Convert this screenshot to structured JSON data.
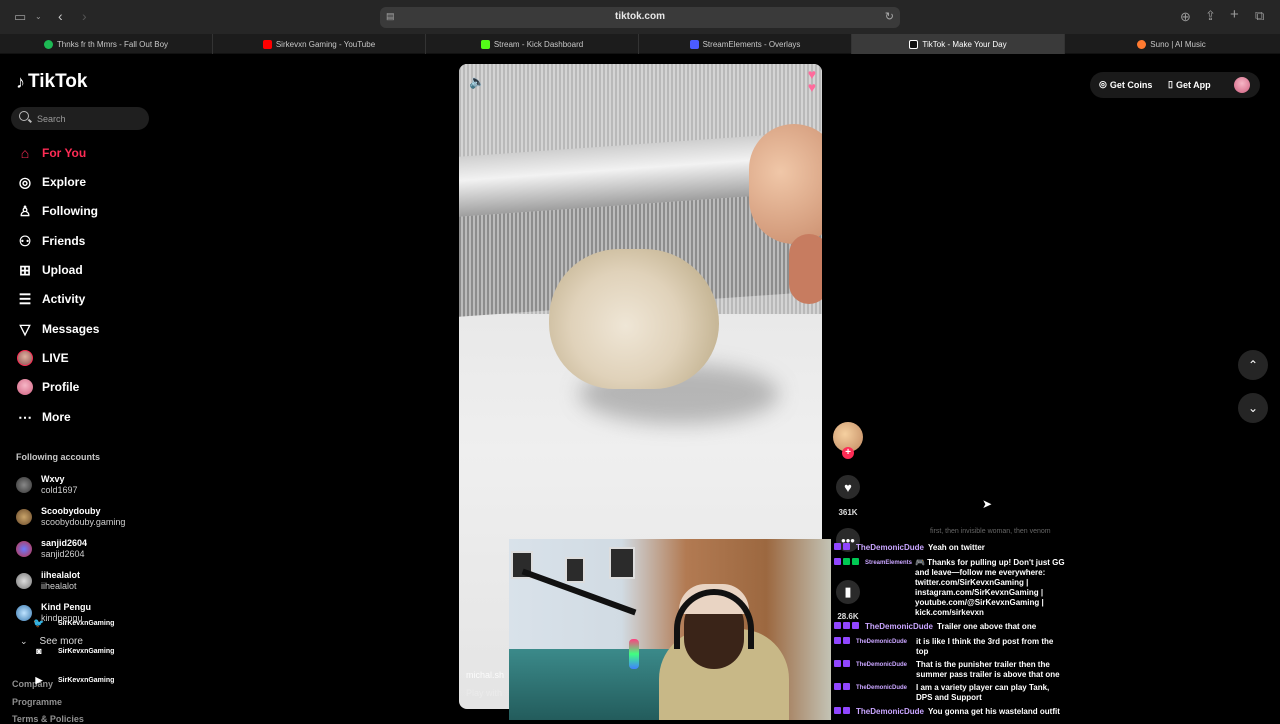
{
  "browser": {
    "url": "tiktok.com",
    "tabs": [
      {
        "label": "Thnks fr th Mmrs - Fall Out Boy",
        "icon": "spotify-icon",
        "color": "#1db954"
      },
      {
        "label": "Sirkevxn Gaming - YouTube",
        "icon": "youtube-icon",
        "color": "#ff0000"
      },
      {
        "label": "Stream - Kick Dashboard",
        "icon": "kick-icon",
        "color": "#53fc18"
      },
      {
        "label": "StreamElements - Overlays",
        "icon": "streamelements-icon",
        "color": "#4b5cff"
      },
      {
        "label": "TikTok - Make Your Day",
        "icon": "tiktok-icon",
        "color": "#ffffff",
        "active": true
      },
      {
        "label": "Suno | AI Music",
        "icon": "suno-icon",
        "color": "#ff7a30"
      }
    ]
  },
  "tiktok": {
    "brand": "TikTok",
    "search_placeholder": "Search",
    "nav": [
      {
        "label": "For You",
        "icon": "home-icon",
        "active": true
      },
      {
        "label": "Explore",
        "icon": "compass-icon"
      },
      {
        "label": "Following",
        "icon": "following-icon"
      },
      {
        "label": "Friends",
        "icon": "friends-icon"
      },
      {
        "label": "Upload",
        "icon": "upload-icon"
      },
      {
        "label": "Activity",
        "icon": "activity-icon"
      },
      {
        "label": "Messages",
        "icon": "messages-icon"
      },
      {
        "label": "LIVE",
        "icon": "live-avatar-icon"
      },
      {
        "label": "Profile",
        "icon": "profile-avatar-icon"
      },
      {
        "label": "More",
        "icon": "more-icon"
      }
    ],
    "following_title": "Following accounts",
    "accounts": [
      {
        "name": "Wxvy",
        "handle": "cold1697"
      },
      {
        "name": "Scoobydouby",
        "handle": "scoobydouby.gaming"
      },
      {
        "name": "sanjid2604",
        "handle": "sanjid2604"
      },
      {
        "name": "iihealalot",
        "handle": "iihealalot"
      },
      {
        "name": "Kind Pengu",
        "handle": "kindpengu"
      }
    ],
    "see_more": "See more",
    "footer": [
      "Company",
      "Programme",
      "Terms & Policies"
    ],
    "top_right": {
      "coins": "Get Coins",
      "app": "Get App"
    },
    "video": {
      "author": "michal.sh",
      "desc": "Play with"
    },
    "actions": {
      "likes": "361K",
      "saves": "28.6K"
    }
  },
  "overlay": {
    "socials": [
      {
        "icon": "twitter-icon",
        "label": "SirKevxnGaming"
      },
      {
        "icon": "instagram-icon",
        "label": "SirKevxnGaming"
      },
      {
        "icon": "youtube-icon",
        "label": "SirKevxnGaming"
      }
    ],
    "chat_faded": "first, then invisible woman, then venom",
    "chat": [
      {
        "user": "TheDemonicDude",
        "msg": "Yeah on twitter"
      },
      {
        "user": "StreamElements",
        "msg": "🎮 Thanks for pulling up! Don't just GG and leave—follow me everywhere: twitter.com/SirKevxnGaming | instagram.com/SirKevxnGaming | youtube.com/@SirKevxnGaming | kick.com/sirkevxn"
      },
      {
        "user": "TheDemonicDude",
        "msg": "Trailer one above that one"
      },
      {
        "user": "TheDemonicDude",
        "msg": "it is like I think the 3rd post from the top"
      },
      {
        "user": "TheDemonicDude",
        "msg": "That is the punisher trailer then the summer pass trailer is above that one"
      },
      {
        "user": "TheDemonicDude",
        "msg": "I am a variety player can play Tank, DPS and Support"
      },
      {
        "user": "TheDemonicDude",
        "msg": "You gonna get his wasteland outfit"
      }
    ]
  }
}
